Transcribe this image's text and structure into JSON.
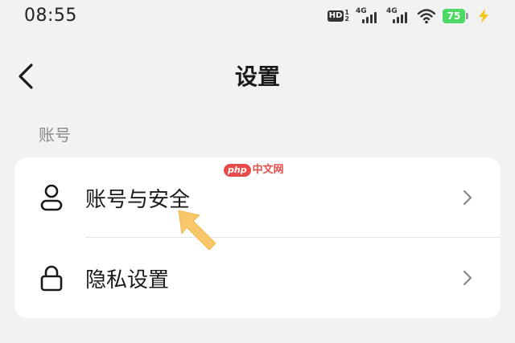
{
  "status_bar": {
    "time": "08:55",
    "hd_label": "HD",
    "hd_sim_top": "1",
    "hd_sim_bottom": "2",
    "network_1": "4G",
    "network_2": "4G",
    "battery_level": "75",
    "battery_color": "#4cd964",
    "charging_color": "#f5c518"
  },
  "nav": {
    "title": "设置",
    "back_icon": "chevron-left-icon"
  },
  "section": {
    "label": "账号"
  },
  "settings_list": {
    "items": [
      {
        "label": "账号与安全",
        "icon": "user-icon"
      },
      {
        "label": "隐私设置",
        "icon": "lock-icon"
      }
    ]
  },
  "watermark": {
    "badge": "php",
    "site": "中文网"
  },
  "annotation": {
    "arrow_color": "#f7c76a"
  }
}
